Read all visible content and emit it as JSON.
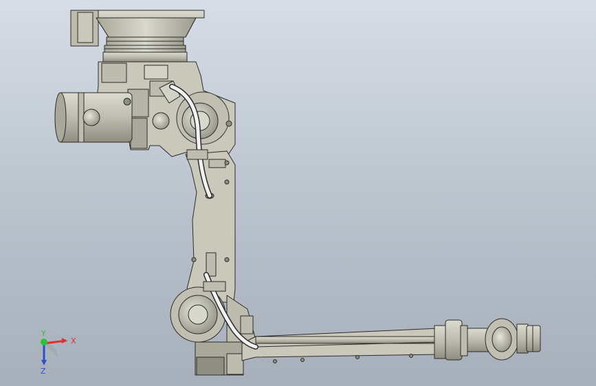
{
  "viewport": {
    "background_top": "#d6dde6",
    "background_bottom": "#a6afba",
    "model": {
      "body_color": "#c9c8bb",
      "edge_color": "#2b2b2b",
      "cable_color": "#f2f2f2"
    }
  },
  "triad": {
    "x_label": "X",
    "y_label": "Y",
    "z_label": "Z",
    "x_color": "#e0302a",
    "y_color": "#2fbf3a",
    "z_color": "#2e4fc9"
  }
}
